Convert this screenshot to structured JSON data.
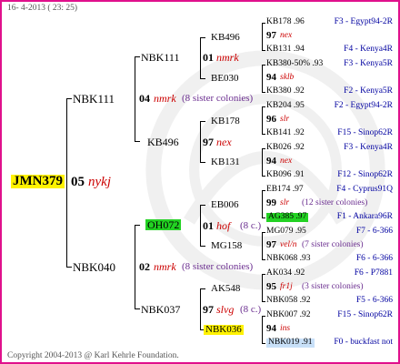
{
  "header": {
    "date_text": "16-  4-2013 ( 23: 25)"
  },
  "footer": {
    "copyright": "Copyright 2004-2013 @ Karl Kehrle Foundation."
  },
  "root": {
    "name": "JMN379"
  },
  "gen1": {
    "score": "05",
    "mating": "nykj",
    "sire": "NBK111",
    "dam": "NBK040"
  },
  "gen2": {
    "a": {
      "score": "04",
      "mating": "nmrk",
      "note": "(8 sister colonies)",
      "sire": "NBK111",
      "dam": "KB496"
    },
    "b": {
      "score": "02",
      "mating": "nmrk",
      "note": "(8 sister colonies)",
      "sire": "OH072",
      "dam": "NBK037"
    }
  },
  "gen3": {
    "a1": {
      "score": "01",
      "mating": "nmrk",
      "sire": "KB496",
      "dam": "BE030"
    },
    "a2": {
      "score": "97",
      "mating": "nex",
      "sire": "KB178",
      "dam": "KB131"
    },
    "b1": {
      "score": "01",
      "mating": "hof",
      "note": "(8 c.)",
      "sire": "EB006",
      "dam": "MG158"
    },
    "b2": {
      "score": "97",
      "mating": "slvg",
      "note": "(8 c.)",
      "sire": "AK548",
      "dam": "NBK036"
    }
  },
  "gen4": [
    {
      "top": "KB178",
      "top_score": ".96",
      "mid_score": "97",
      "mid_mating": "nex",
      "bottom": "KB131",
      "bottom_score": ".94"
    },
    {
      "top": "KB380-50%",
      "top_score": ".93",
      "mid_score": "94",
      "mid_mating": "sklb",
      "bottom": "KB380",
      "bottom_score": ".92"
    },
    {
      "top": "KB204",
      "top_score": ".95",
      "mid_score": "96",
      "mid_mating": "slr",
      "bottom": "KB141",
      "bottom_score": ".92"
    },
    {
      "top": "KB026",
      "top_score": ".92",
      "mid_score": "94",
      "mid_mating": "nex",
      "bottom": "KB096",
      "bottom_score": ".91"
    },
    {
      "top": "EB174",
      "top_score": ".97",
      "mid_score": "99",
      "mid_mating": "slr",
      "mid_note": "(12 sister colonies)",
      "bottom": "AG385",
      "bottom_score": ".97"
    },
    {
      "top": "MG079",
      "top_score": ".95",
      "mid_score": "97",
      "mid_mating": "vel/n",
      "mid_note": "(7 sister colonies)",
      "bottom": "NBK068",
      "bottom_score": ".93"
    },
    {
      "top": "AK034",
      "top_score": ".92",
      "mid_score": "95",
      "mid_mating": "fr1j",
      "mid_note": "(3 sister colonies)",
      "bottom": "NBK058",
      "bottom_score": ".92"
    },
    {
      "top": "NBK007",
      "top_score": ".92",
      "mid_score": "94",
      "mid_mating": "ins",
      "bottom": "NBK019",
      "bottom_score": ".91"
    }
  ],
  "origins": [
    "F3 - Egypt94-2R",
    "F4 - Kenya4R",
    "F3 - Kenya5R",
    "F2 - Kenya5R",
    "F2 - Egypt94-2R",
    "F15 - Sinop62R",
    "F3 - Kenya4R",
    "F12 - Sinop62R",
    "F4 - Cyprus91Q",
    "F1 - Ankara96R",
    "F7 - 6-366",
    "F6 - 6-366",
    "F6 - P7881",
    "F5 - 6-366",
    "F15 - Sinop62R",
    "F0 - buckfast not"
  ]
}
